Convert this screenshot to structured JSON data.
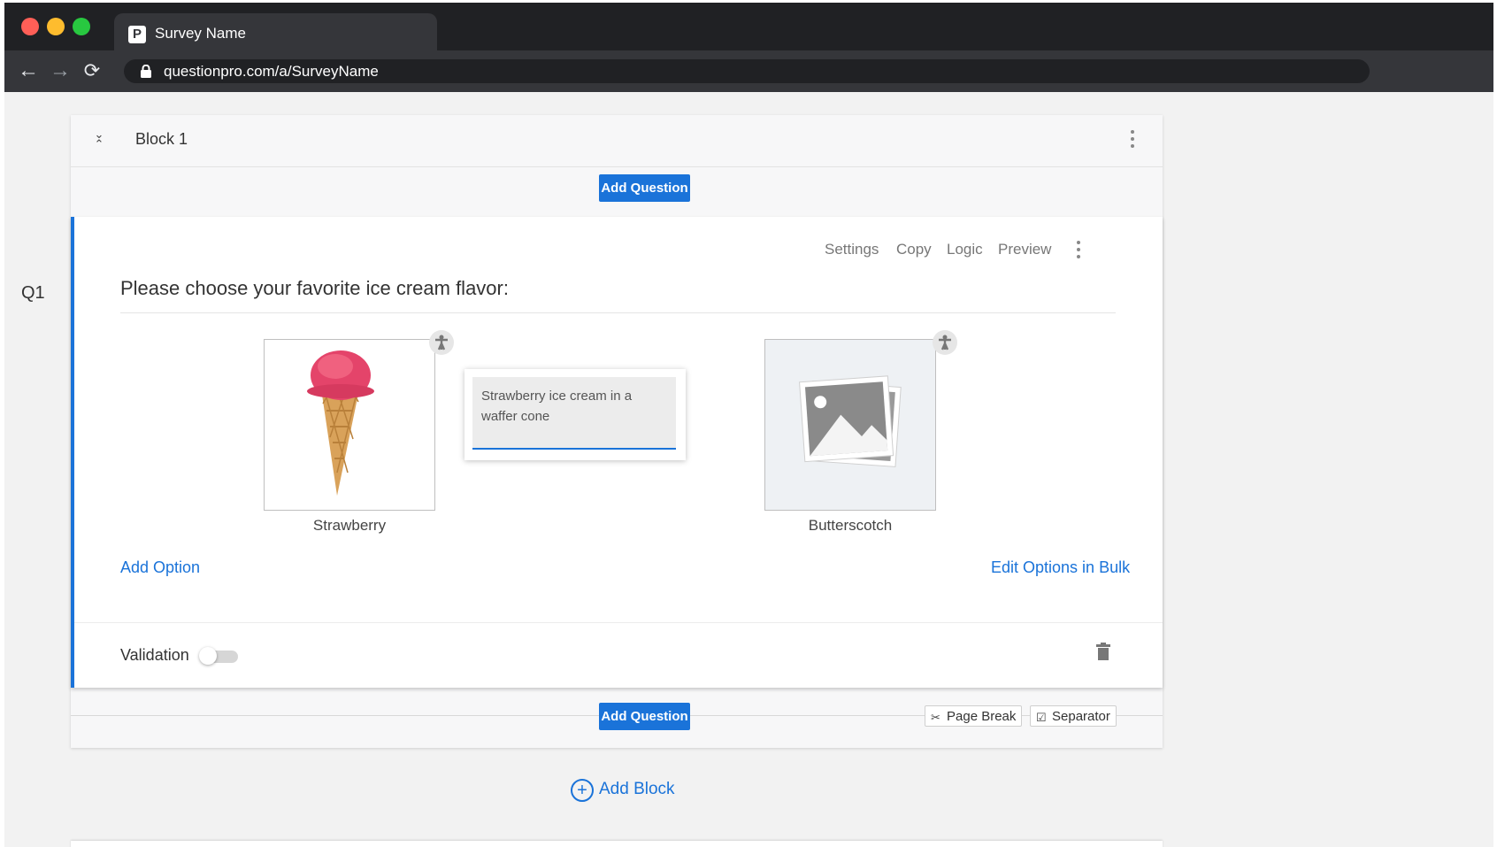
{
  "browser": {
    "tab_title": "Survey Name",
    "favicon_letter": "P",
    "url": "questionpro.com/a/SurveyName",
    "nav": {
      "back_icon": "←",
      "forward_icon": "→",
      "reload_icon": "⟳"
    }
  },
  "question_number": "Q1",
  "block": {
    "title": "Block 1",
    "add_question_label": "Add Question"
  },
  "question": {
    "tools": [
      "Settings",
      "Copy",
      "Logic",
      "Preview"
    ],
    "text": "Please choose your favorite ice cream flavor:",
    "options": [
      {
        "label": "Strawberry"
      },
      {
        "label": "Butterscotch"
      }
    ],
    "alt_text_popup": "Strawberry ice cream in a waffer cone",
    "add_option_label": "Add Option",
    "edit_bulk_label": "Edit Options in Bulk",
    "validation_label": "Validation",
    "validation_on": false
  },
  "footer": {
    "add_question_label": "Add Question",
    "page_break_label": "Page Break",
    "separator_label": "Separator"
  },
  "add_block_label": "Add Block",
  "colors": {
    "accent": "#1a73d9",
    "chrome_dark": "#202124",
    "chrome_toolbar": "#35363a",
    "page_bg": "#f2f2f2"
  }
}
